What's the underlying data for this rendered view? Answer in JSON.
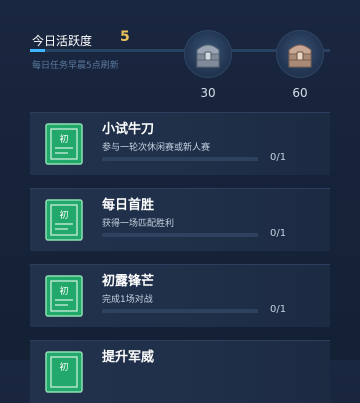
{
  "activity": {
    "label": "今日活跃度",
    "value": "5",
    "refresh_note": "每日任务早晨5点刷新",
    "progress": 0.05
  },
  "chests": [
    {
      "icon": "silver-chest-icon",
      "threshold": "30"
    },
    {
      "icon": "gold-chest-icon",
      "threshold": "60"
    }
  ],
  "tasks": [
    {
      "icon_label": "初",
      "title": "小试牛刀",
      "desc": "参与一轮次休闲赛或新人赛",
      "progress": "0/1",
      "fraction": 0
    },
    {
      "icon_label": "初",
      "title": "每日首胜",
      "desc": "获得一场匹配胜利",
      "progress": "0/1",
      "fraction": 0
    },
    {
      "icon_label": "初",
      "title": "初露锋芒",
      "desc": "完成1场对战",
      "progress": "0/1",
      "fraction": 0
    },
    {
      "icon_label": "初",
      "title": "提升军威",
      "desc": "",
      "progress": "",
      "fraction": 0
    }
  ],
  "colors": {
    "accent": "#3fb6ff",
    "gold": "#e9c25a",
    "task_icon": "#22a86a"
  }
}
